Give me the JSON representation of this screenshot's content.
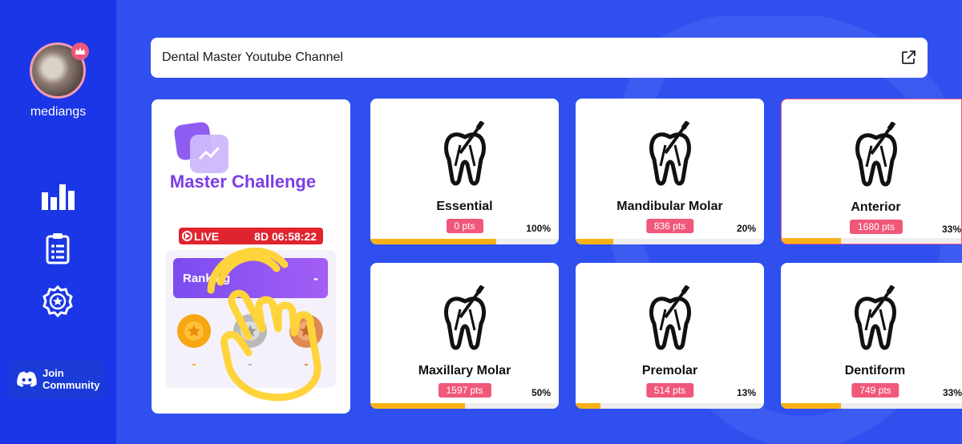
{
  "user": {
    "name": "mediangs"
  },
  "sidebar": {
    "nav": [
      {
        "icon": "bar-chart-icon"
      },
      {
        "icon": "clipboard-list-icon"
      },
      {
        "icon": "badge-settings-icon"
      }
    ],
    "community_label": "Join Community"
  },
  "linkbar": {
    "text": "Dental Master Youtube Channel",
    "icon": "external-link-icon"
  },
  "challenge": {
    "title": "Master Challenge",
    "live_label": "LIVE",
    "timer": "8D 06:58:22",
    "ranking_label": "Ranking",
    "ranking_value": "-",
    "medals": [
      {
        "name": "gold",
        "value": "-"
      },
      {
        "name": "silver",
        "value": "-"
      },
      {
        "name": "bronze",
        "value": "-"
      }
    ]
  },
  "colors": {
    "accent": "#2f50ef",
    "sidebar": "#1b36e6",
    "pts": "#f0587a",
    "progress": "#fbb116",
    "purple": "#7b3fe4"
  },
  "courses": [
    {
      "title": "Essential",
      "pts": "0 pts",
      "percent": "100%",
      "progress": 0.67
    },
    {
      "title": "Mandibular Molar",
      "pts": "836 pts",
      "percent": "20%",
      "progress": 0.2
    },
    {
      "title": "Anterior",
      "pts": "1680 pts",
      "percent": "33%",
      "progress": 0.33
    },
    {
      "title": "Maxillary Molar",
      "pts": "1597 pts",
      "percent": "50%",
      "progress": 0.5
    },
    {
      "title": "Premolar",
      "pts": "514 pts",
      "percent": "13%",
      "progress": 0.13
    },
    {
      "title": "Dentiform",
      "pts": "749 pts",
      "percent": "33%",
      "progress": 0.33
    }
  ]
}
